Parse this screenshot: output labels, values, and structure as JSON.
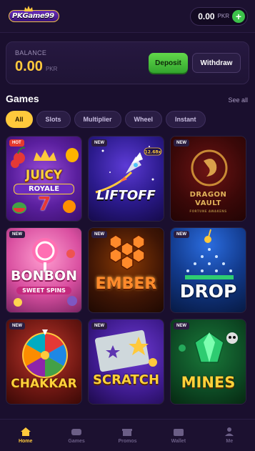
{
  "header": {
    "logo_text": "PKGame99",
    "wallet_amount": "0.00",
    "wallet_currency": "PKR",
    "add_label": "+"
  },
  "balance": {
    "label": "BALANCE",
    "amount": "0.00",
    "currency": "PKR",
    "deposit_label": "Deposit",
    "withdraw_label": "Withdraw"
  },
  "games": {
    "title": "Games",
    "see_all": "See all",
    "tabs": [
      {
        "label": "All",
        "active": true
      },
      {
        "label": "Slots",
        "active": false
      },
      {
        "label": "Multiplier",
        "active": false
      },
      {
        "label": "Wheel",
        "active": false
      },
      {
        "label": "Instant",
        "active": false
      }
    ],
    "tiles": [
      {
        "badge": "HOT",
        "title_line1": "JUICY",
        "title_line2": "ROYALE",
        "extra": "7"
      },
      {
        "badge": "NEW",
        "title_line1": "LIFTOFF",
        "multiplier": "12.68x"
      },
      {
        "badge": "NEW",
        "title_line1": "DRAGON",
        "title_line2": "VAULT",
        "title_line3": "FORTUNE AWAKENS"
      },
      {
        "badge": "NEW",
        "title_line1": "BONBON",
        "title_line2": "SWEET SPINS"
      },
      {
        "badge": "NEW",
        "title_line1": "EMBER"
      },
      {
        "badge": "NEW",
        "title_line1": "DROP"
      },
      {
        "badge": "NEW",
        "title_line1": "CHAKKAR"
      },
      {
        "badge": "NEW",
        "title_line1": "SCRATCH"
      },
      {
        "badge": "NEW",
        "title_line1": "MINES"
      }
    ]
  },
  "nav": [
    {
      "label": "Home",
      "icon": "home-icon",
      "active": true
    },
    {
      "label": "Games",
      "icon": "games-icon",
      "active": false
    },
    {
      "label": "Promos",
      "icon": "gift-icon",
      "active": false
    },
    {
      "label": "Wallet",
      "icon": "wallet-icon",
      "active": false
    },
    {
      "label": "Me",
      "icon": "user-icon",
      "active": false
    }
  ],
  "colors": {
    "background": "#1a0f2e",
    "accent_gold": "#ffc93c",
    "deposit_green": "#3cc24a"
  }
}
